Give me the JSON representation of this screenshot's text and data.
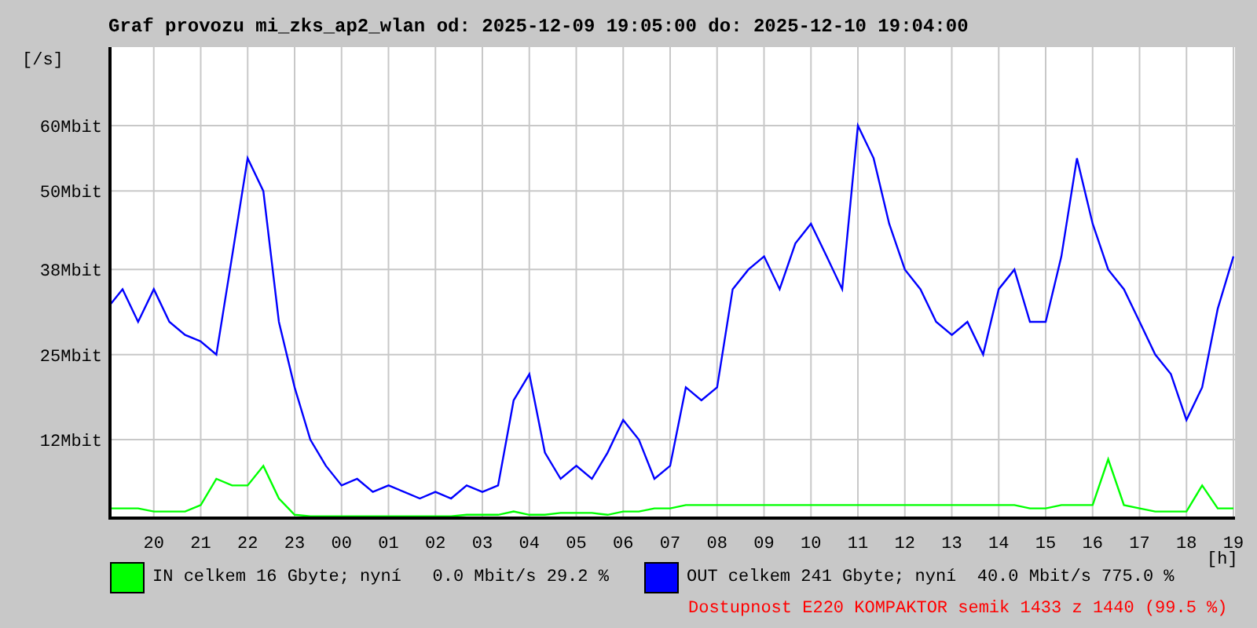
{
  "title": "Graf provozu mi_zks_ap2_wlan od: 2025-12-09 19:05:00 do: 2025-12-10 19:04:00",
  "graph": {
    "unit_label": "[/s]",
    "x_unit_label": "[h]",
    "chart_data": {
      "type": "line",
      "categories": [
        null,
        null,
        null,
        "20",
        null,
        null,
        "21",
        null,
        null,
        "22",
        null,
        null,
        "23",
        null,
        null,
        "00",
        null,
        null,
        "01",
        null,
        null,
        "02",
        null,
        null,
        "03",
        null,
        null,
        "04",
        null,
        null,
        "05",
        null,
        null,
        "06",
        null,
        null,
        "07",
        null,
        null,
        "08",
        null,
        null,
        "09",
        null,
        null,
        "10",
        null,
        null,
        "11",
        null,
        null,
        "12",
        null,
        null,
        "13",
        null,
        null,
        "14",
        null,
        null,
        "15",
        null,
        null,
        "16",
        null,
        null,
        "17",
        null,
        null,
        "18",
        null,
        null,
        "19"
      ],
      "series": [
        {
          "name": "IN",
          "color": "#00ff00",
          "values": [
            1.5,
            1.5,
            1.5,
            1,
            1,
            1,
            2,
            6,
            5,
            5,
            8,
            3,
            0.5,
            0.3,
            0.3,
            0.3,
            0.3,
            0.3,
            0.3,
            0.3,
            0.3,
            0.3,
            0.3,
            0.5,
            0.5,
            0.5,
            1,
            0.5,
            0.5,
            0.8,
            0.8,
            0.8,
            0.5,
            1,
            1,
            1.5,
            1.5,
            2,
            2,
            2,
            2,
            2,
            2,
            2,
            2,
            2,
            2,
            2,
            2,
            2,
            2,
            2,
            2,
            2,
            2,
            2,
            2,
            2,
            2,
            1.5,
            1.5,
            2,
            2,
            2,
            9,
            2,
            1.5,
            1,
            1,
            1,
            5,
            1.5,
            1.5
          ]
        },
        {
          "name": "OUT",
          "color": "#0000ff",
          "values": [
            32,
            35,
            30,
            35,
            30,
            28,
            27,
            25,
            40,
            55,
            50,
            30,
            20,
            12,
            8,
            5,
            6,
            4,
            5,
            4,
            3,
            4,
            3,
            5,
            4,
            5,
            18,
            22,
            10,
            6,
            8,
            6,
            10,
            15,
            12,
            6,
            8,
            20,
            18,
            20,
            35,
            38,
            40,
            35,
            42,
            45,
            40,
            35,
            60,
            55,
            45,
            38,
            35,
            30,
            28,
            30,
            25,
            35,
            38,
            30,
            30,
            40,
            55,
            45,
            38,
            35,
            30,
            25,
            22,
            15,
            20,
            32,
            40
          ]
        }
      ],
      "ylim": [
        0,
        72
      ],
      "grid": true,
      "yticks": [
        {
          "value": 12,
          "label": "12Mbit"
        },
        {
          "value": 25,
          "label": "25Mbit"
        },
        {
          "value": 38,
          "label": "38Mbit"
        },
        {
          "value": 50,
          "label": "50Mbit"
        },
        {
          "value": 60,
          "label": "60Mbit"
        }
      ]
    }
  },
  "legend": [
    {
      "text": "celkem 16 Gbyte; nyní   0.0 Mbit/s 29.2 %"
    },
    {
      "text": "celkem 241 Gbyte; nyní  40.0 Mbit/s 775.0 %"
    }
  ],
  "availability": "Dostupnost E220 KOMPAKTOR semik 1433 z 1440 (99.5 %)"
}
